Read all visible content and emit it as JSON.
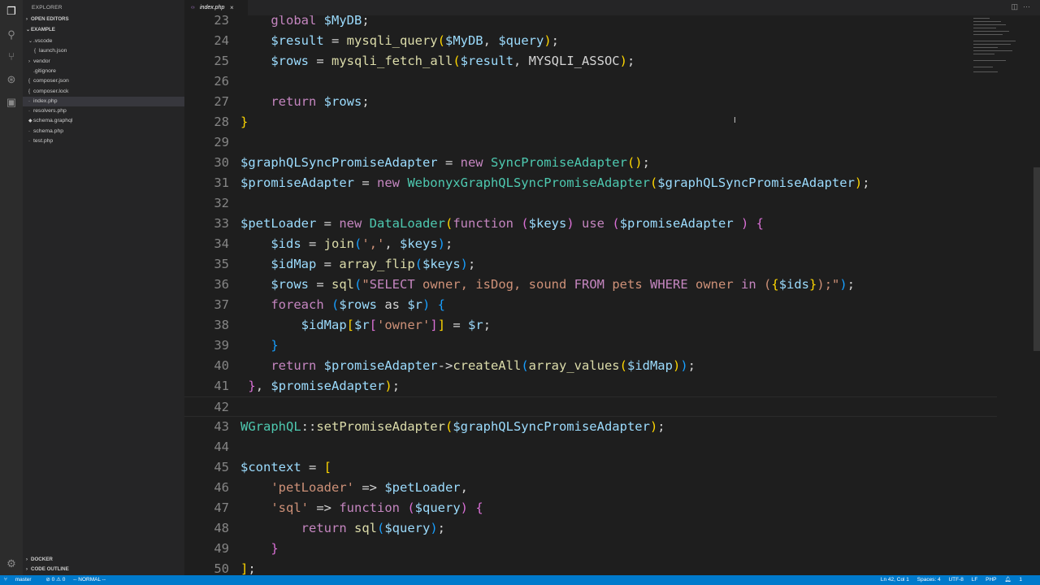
{
  "sidebar": {
    "title": "EXPLORER",
    "open_editors": "OPEN EDITORS",
    "project": "EXAMPLE",
    "items": [
      {
        "label": ".vscode",
        "kind": "folder-open",
        "indent": 1
      },
      {
        "label": "launch.json",
        "kind": "json",
        "indent": 2
      },
      {
        "label": "vendor",
        "kind": "folder",
        "indent": 1
      },
      {
        "label": ".gitignore",
        "kind": "file",
        "indent": 1
      },
      {
        "label": "composer.json",
        "kind": "json",
        "indent": 1
      },
      {
        "label": "composer.lock",
        "kind": "json",
        "indent": 1
      },
      {
        "label": "index.php",
        "kind": "php",
        "indent": 1,
        "selected": true
      },
      {
        "label": "resolvers.php",
        "kind": "php",
        "indent": 1
      },
      {
        "label": "schema.graphql",
        "kind": "graphql",
        "indent": 1
      },
      {
        "label": "schema.php",
        "kind": "php",
        "indent": 1
      },
      {
        "label": "test.php",
        "kind": "php",
        "indent": 1
      }
    ],
    "docker": "DOCKER",
    "outline": "CODE OUTLINE"
  },
  "editor": {
    "tab_label": "index.php",
    "tab_close": "×",
    "lines": [
      {
        "n": "23",
        "segs": [
          [
            "    ",
            "op"
          ],
          [
            "global ",
            "kw"
          ],
          [
            "$MyDB",
            "var"
          ],
          [
            ";",
            "op"
          ]
        ]
      },
      {
        "n": "24",
        "segs": [
          [
            "    ",
            "op"
          ],
          [
            "$result",
            "var"
          ],
          [
            " = ",
            "op"
          ],
          [
            "mysqli_query",
            "fn"
          ],
          [
            "(",
            "b1"
          ],
          [
            "$MyDB",
            "var"
          ],
          [
            ", ",
            "op"
          ],
          [
            "$query",
            "var"
          ],
          [
            ")",
            "b1"
          ],
          [
            ";",
            "op"
          ]
        ]
      },
      {
        "n": "25",
        "segs": [
          [
            "    ",
            "op"
          ],
          [
            "$rows",
            "var"
          ],
          [
            " = ",
            "op"
          ],
          [
            "mysqli_fetch_all",
            "fn"
          ],
          [
            "(",
            "b1"
          ],
          [
            "$result",
            "var"
          ],
          [
            ", ",
            "op"
          ],
          [
            "MYSQLI_ASSOC",
            "op"
          ],
          [
            ")",
            "b1"
          ],
          [
            ";",
            "op"
          ]
        ]
      },
      {
        "n": "26",
        "segs": []
      },
      {
        "n": "27",
        "segs": [
          [
            "    ",
            "op"
          ],
          [
            "return ",
            "kw"
          ],
          [
            "$rows",
            "var"
          ],
          [
            ";",
            "op"
          ]
        ]
      },
      {
        "n": "28",
        "segs": [
          [
            "}",
            "b1"
          ]
        ]
      },
      {
        "n": "29",
        "segs": []
      },
      {
        "n": "30",
        "segs": [
          [
            "$graphQLSyncPromiseAdapter",
            "var"
          ],
          [
            " = ",
            "op"
          ],
          [
            "new ",
            "kw"
          ],
          [
            "SyncPromiseAdapter",
            "cls"
          ],
          [
            "()",
            "b1"
          ],
          [
            ";",
            "op"
          ]
        ]
      },
      {
        "n": "31",
        "segs": [
          [
            "$promiseAdapter",
            "var"
          ],
          [
            " = ",
            "op"
          ],
          [
            "new ",
            "kw"
          ],
          [
            "WebonyxGraphQLSyncPromiseAdapter",
            "cls"
          ],
          [
            "(",
            "b1"
          ],
          [
            "$graphQLSyncPromiseAdapter",
            "var"
          ],
          [
            ")",
            "b1"
          ],
          [
            ";",
            "op"
          ]
        ]
      },
      {
        "n": "32",
        "segs": []
      },
      {
        "n": "33",
        "segs": [
          [
            "$petLoader",
            "var"
          ],
          [
            " = ",
            "op"
          ],
          [
            "new ",
            "kw"
          ],
          [
            "DataLoader",
            "cls"
          ],
          [
            "(",
            "b1"
          ],
          [
            "function ",
            "kw"
          ],
          [
            "(",
            "b2"
          ],
          [
            "$keys",
            "var"
          ],
          [
            ") ",
            "b2"
          ],
          [
            "use ",
            "kw"
          ],
          [
            "(",
            "b2"
          ],
          [
            "$promiseAdapter",
            "var"
          ],
          [
            " ) ",
            "b2"
          ],
          [
            "{",
            "b2"
          ]
        ]
      },
      {
        "n": "34",
        "segs": [
          [
            "    ",
            "op"
          ],
          [
            "$ids",
            "var"
          ],
          [
            " = ",
            "op"
          ],
          [
            "join",
            "fn"
          ],
          [
            "(",
            "b3"
          ],
          [
            "','",
            "str"
          ],
          [
            ", ",
            "op"
          ],
          [
            "$keys",
            "var"
          ],
          [
            ")",
            "b3"
          ],
          [
            ";",
            "op"
          ]
        ]
      },
      {
        "n": "35",
        "segs": [
          [
            "    ",
            "op"
          ],
          [
            "$idMap",
            "var"
          ],
          [
            " = ",
            "op"
          ],
          [
            "array_flip",
            "fn"
          ],
          [
            "(",
            "b3"
          ],
          [
            "$keys",
            "var"
          ],
          [
            ")",
            "b3"
          ],
          [
            ";",
            "op"
          ]
        ]
      },
      {
        "n": "36",
        "segs": [
          [
            "    ",
            "op"
          ],
          [
            "$rows",
            "var"
          ],
          [
            " = ",
            "op"
          ],
          [
            "sql",
            "fn"
          ],
          [
            "(",
            "b3"
          ],
          [
            "\"",
            "str"
          ],
          [
            "SELECT ",
            "kw"
          ],
          [
            "owner, isDog, sound ",
            "str"
          ],
          [
            "FROM ",
            "kw"
          ],
          [
            "pets ",
            "str"
          ],
          [
            "WHERE ",
            "kw"
          ],
          [
            "owner ",
            "str"
          ],
          [
            "in ",
            "kw"
          ],
          [
            "(",
            "str"
          ],
          [
            "{",
            "b1"
          ],
          [
            "$ids",
            "var"
          ],
          [
            "}",
            "b1"
          ],
          [
            ");\"",
            "str"
          ],
          [
            ")",
            "b3"
          ],
          [
            ";",
            "op"
          ]
        ]
      },
      {
        "n": "37",
        "segs": [
          [
            "    ",
            "op"
          ],
          [
            "foreach ",
            "kw"
          ],
          [
            "(",
            "b3"
          ],
          [
            "$rows",
            "var"
          ],
          [
            " as ",
            "op"
          ],
          [
            "$r",
            "var"
          ],
          [
            ") ",
            "b3"
          ],
          [
            "{",
            "b3"
          ]
        ]
      },
      {
        "n": "38",
        "segs": [
          [
            "        ",
            "op"
          ],
          [
            "$idMap",
            "var"
          ],
          [
            "[",
            "b1"
          ],
          [
            "$r",
            "var"
          ],
          [
            "[",
            "b2"
          ],
          [
            "'owner'",
            "str"
          ],
          [
            "]",
            "b2"
          ],
          [
            "]",
            "b1"
          ],
          [
            " = ",
            "op"
          ],
          [
            "$r",
            "var"
          ],
          [
            ";",
            "op"
          ]
        ]
      },
      {
        "n": "39",
        "segs": [
          [
            "    ",
            "op"
          ],
          [
            "}",
            "b3"
          ]
        ]
      },
      {
        "n": "40",
        "segs": [
          [
            "    ",
            "op"
          ],
          [
            "return ",
            "kw"
          ],
          [
            "$promiseAdapter",
            "var"
          ],
          [
            "->",
            "op"
          ],
          [
            "createAll",
            "fn"
          ],
          [
            "(",
            "b3"
          ],
          [
            "array_values",
            "fn"
          ],
          [
            "(",
            "b1"
          ],
          [
            "$idMap",
            "var"
          ],
          [
            ")",
            "b1"
          ],
          [
            ")",
            "b3"
          ],
          [
            ";",
            "op"
          ]
        ]
      },
      {
        "n": "41",
        "segs": [
          [
            " ",
            "op"
          ],
          [
            "}",
            "b2"
          ],
          [
            ", ",
            "op"
          ],
          [
            "$promiseAdapter",
            "var"
          ],
          [
            ")",
            "b1"
          ],
          [
            ";",
            "op"
          ]
        ]
      },
      {
        "n": "42",
        "segs": [],
        "current": true
      },
      {
        "n": "43",
        "segs": [
          [
            "WGraphQL",
            "cls"
          ],
          [
            "::",
            "op"
          ],
          [
            "setPromiseAdapter",
            "fn"
          ],
          [
            "(",
            "b1"
          ],
          [
            "$graphQLSyncPromiseAdapter",
            "var"
          ],
          [
            ")",
            "b1"
          ],
          [
            ";",
            "op"
          ]
        ]
      },
      {
        "n": "44",
        "segs": []
      },
      {
        "n": "45",
        "segs": [
          [
            "$context",
            "var"
          ],
          [
            " = ",
            "op"
          ],
          [
            "[",
            "b1"
          ]
        ]
      },
      {
        "n": "46",
        "segs": [
          [
            "    ",
            "op"
          ],
          [
            "'petLoader'",
            "str"
          ],
          [
            " => ",
            "op"
          ],
          [
            "$petLoader",
            "var"
          ],
          [
            ",",
            "op"
          ]
        ]
      },
      {
        "n": "47",
        "segs": [
          [
            "    ",
            "op"
          ],
          [
            "'sql'",
            "str"
          ],
          [
            " => ",
            "op"
          ],
          [
            "function ",
            "kw"
          ],
          [
            "(",
            "b2"
          ],
          [
            "$query",
            "var"
          ],
          [
            ") ",
            "b2"
          ],
          [
            "{",
            "b2"
          ]
        ]
      },
      {
        "n": "48",
        "segs": [
          [
            "        ",
            "op"
          ],
          [
            "return ",
            "kw"
          ],
          [
            "sql",
            "fn"
          ],
          [
            "(",
            "b3"
          ],
          [
            "$query",
            "var"
          ],
          [
            ")",
            "b3"
          ],
          [
            ";",
            "op"
          ]
        ]
      },
      {
        "n": "49",
        "segs": [
          [
            "    ",
            "op"
          ],
          [
            "}",
            "b2"
          ]
        ]
      },
      {
        "n": "50",
        "segs": [
          [
            "]",
            "b1"
          ],
          [
            ";",
            "op"
          ]
        ]
      }
    ]
  },
  "statusbar": {
    "branch": "master",
    "problems": "⊘ 0 ⚠ 0",
    "mode": "-- NORMAL --",
    "position": "Ln 42, Col 1",
    "spaces": "Spaces: 4",
    "encoding": "UTF-8",
    "eol": "LF",
    "language": "PHP",
    "notifications": "1"
  },
  "colors": {
    "accent": "#007acc",
    "sidebar_bg": "#252526",
    "editor_bg": "#1e1e1e"
  },
  "icons": [
    "files-icon",
    "search-icon",
    "source-control-icon",
    "debug-icon",
    "extensions-icon",
    "settings-gear-icon"
  ]
}
